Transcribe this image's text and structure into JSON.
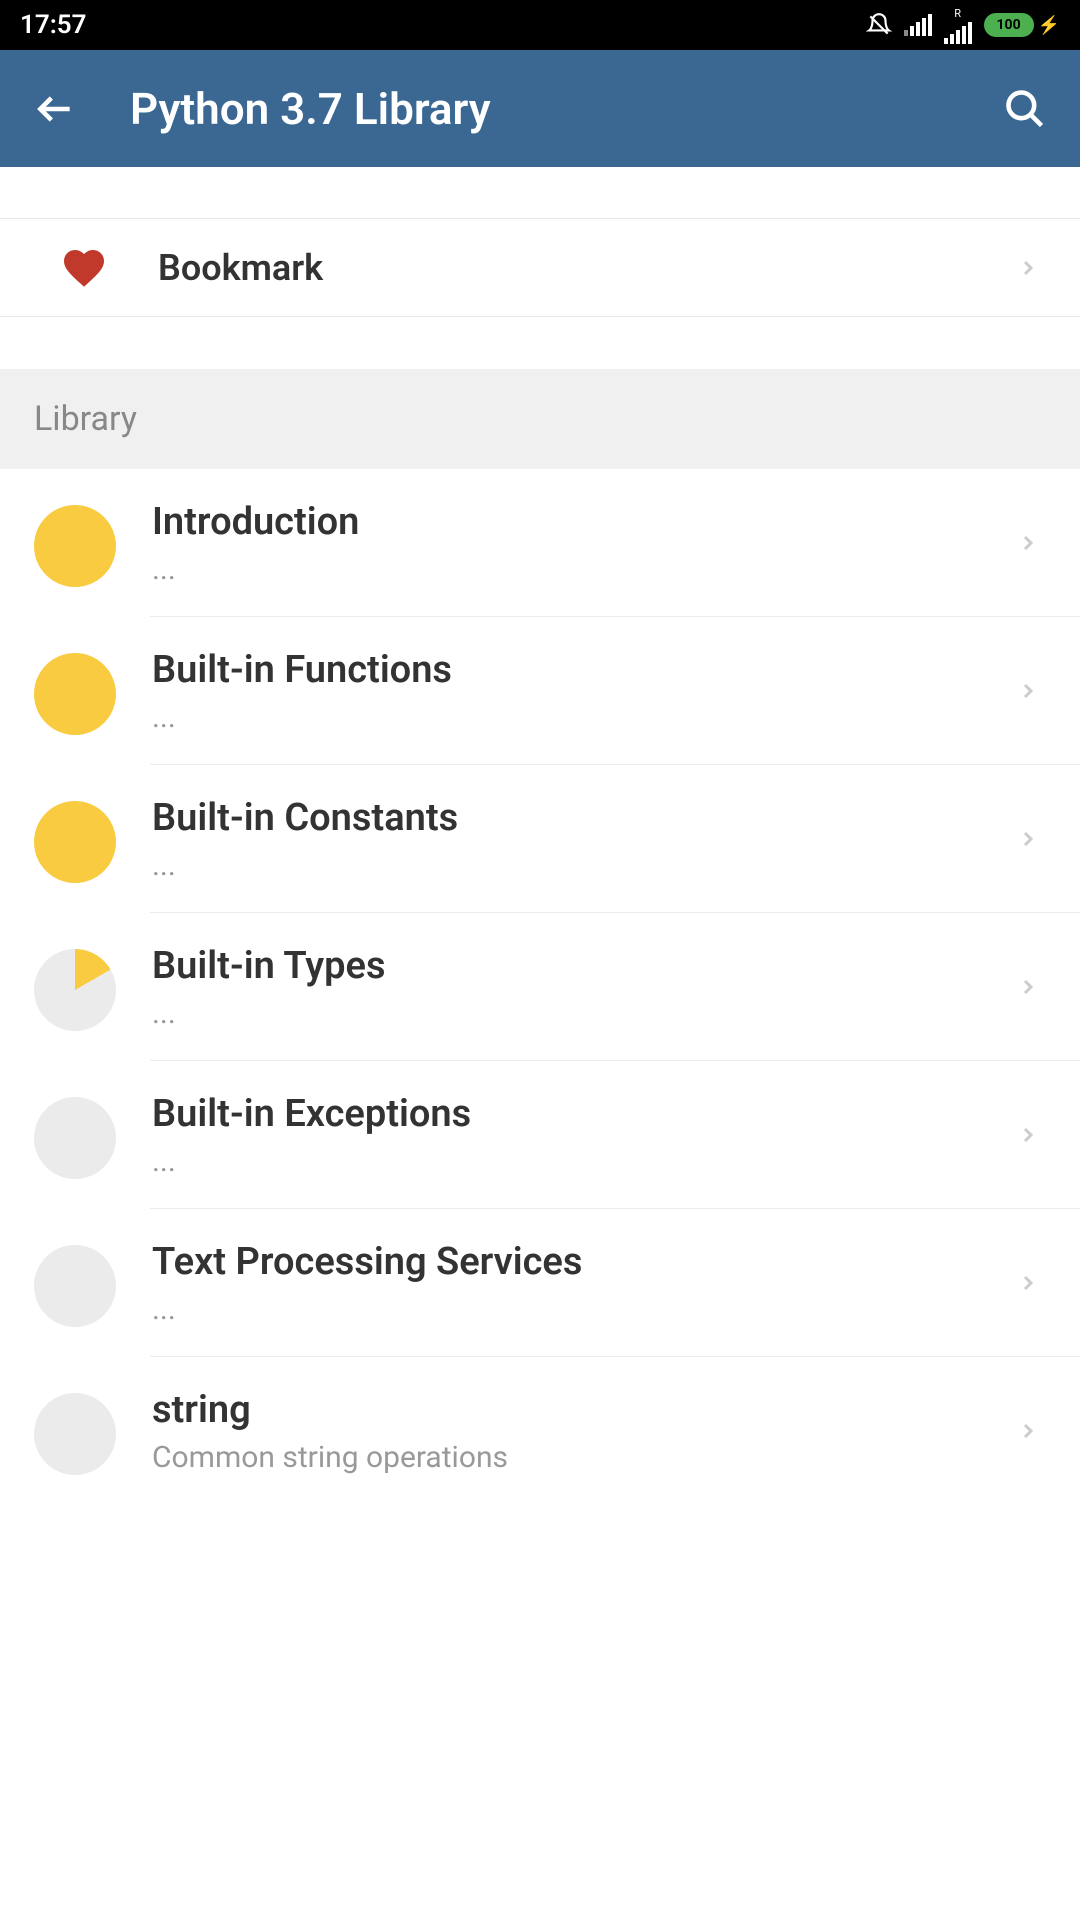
{
  "status": {
    "time": "17:57",
    "battery": "100"
  },
  "header": {
    "title": "Python 3.7 Library"
  },
  "bookmark": {
    "label": "Bookmark"
  },
  "section": {
    "label": "Library"
  },
  "items": [
    {
      "title": "Introduction",
      "subtitle": "...",
      "progress": "full"
    },
    {
      "title": "Built-in Functions",
      "subtitle": "...",
      "progress": "full"
    },
    {
      "title": "Built-in Constants",
      "subtitle": "...",
      "progress": "full"
    },
    {
      "title": "Built-in Types",
      "subtitle": "...",
      "progress": "partial"
    },
    {
      "title": "Built-in Exceptions",
      "subtitle": "...",
      "progress": "empty"
    },
    {
      "title": "Text Processing Services",
      "subtitle": "...",
      "progress": "empty"
    },
    {
      "title": "string",
      "subtitle": "Common string operations",
      "progress": "empty"
    }
  ]
}
